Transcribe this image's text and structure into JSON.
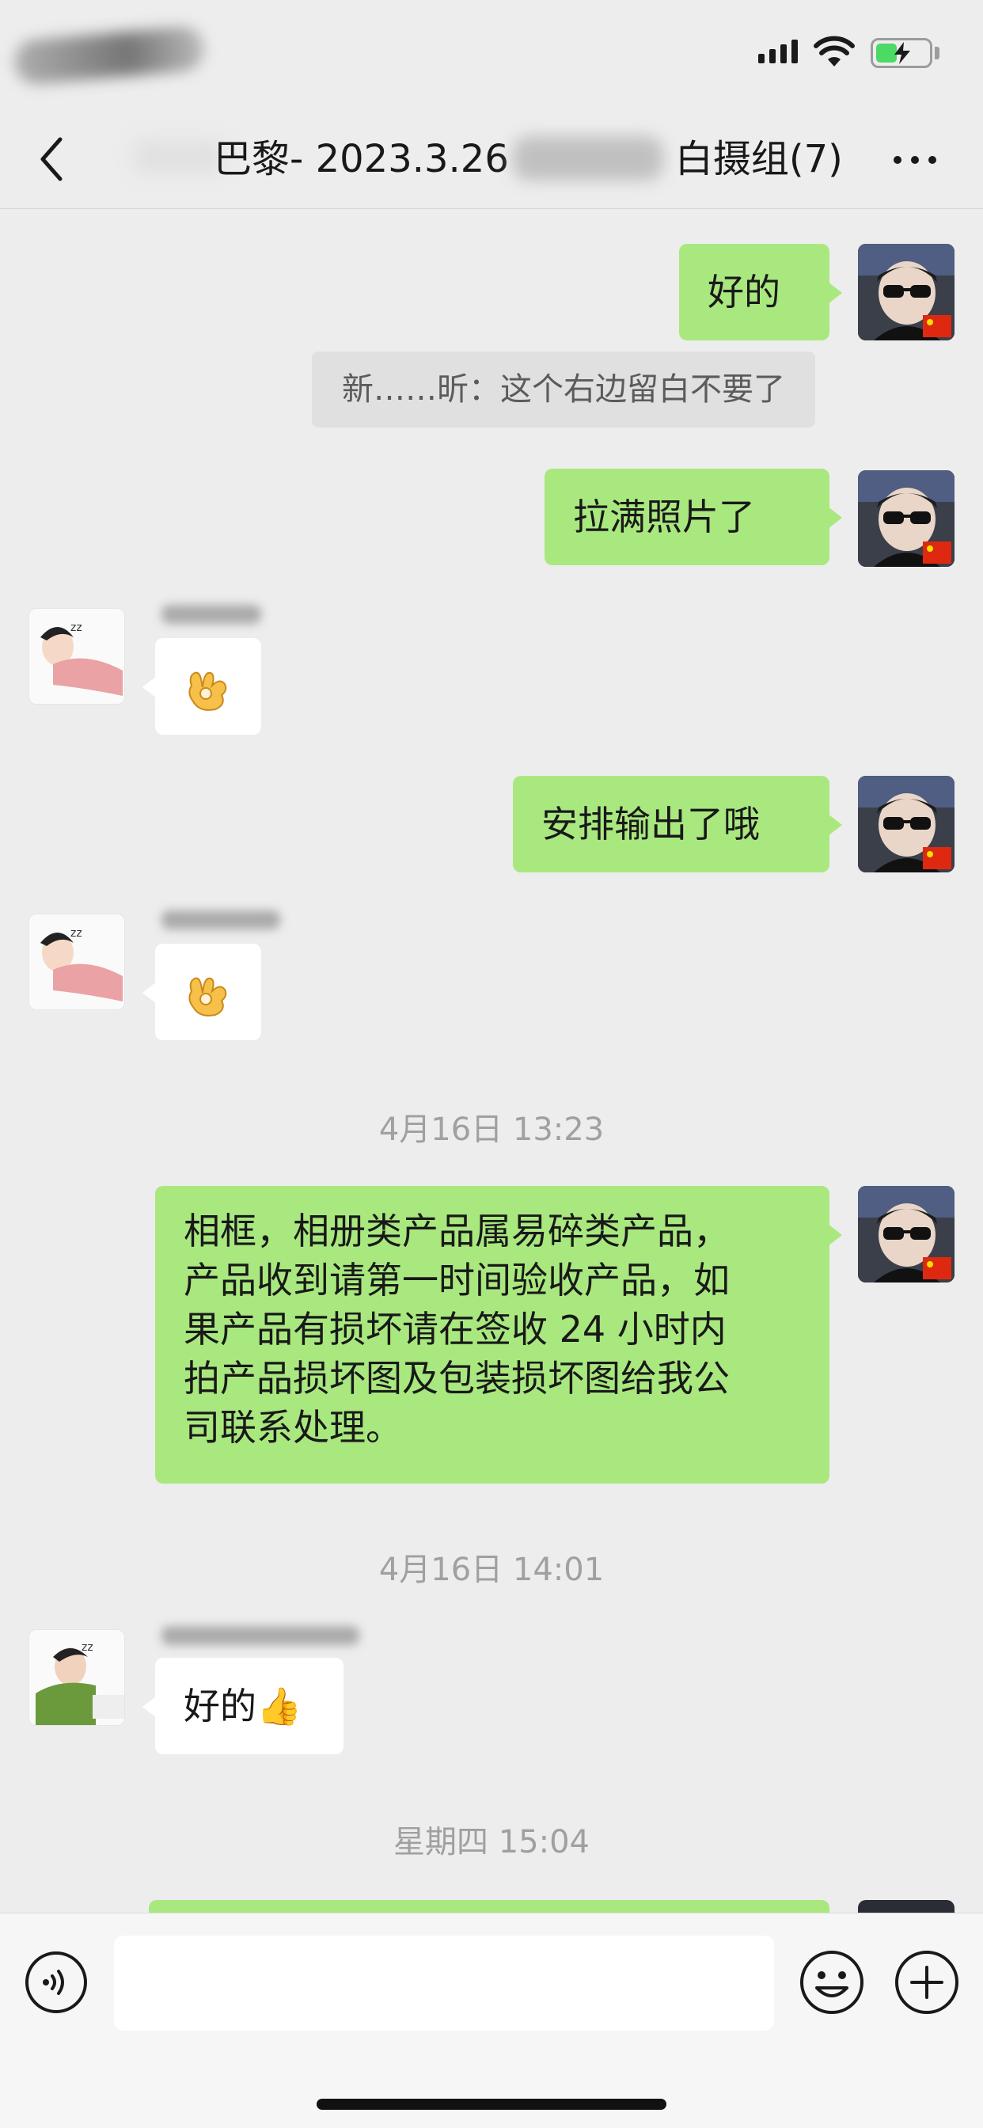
{
  "nav": {
    "title_prefix": "巴黎- 2023.3.26",
    "title_suffix": "白摄组(7)"
  },
  "messages": [
    {
      "side": "me",
      "text": "好的"
    },
    {
      "side": "quote",
      "text": "新……昕：这个右边留白不要了"
    },
    {
      "side": "me",
      "text": "拉满照片了"
    },
    {
      "side": "them",
      "emoji": "ok-hand"
    },
    {
      "side": "me",
      "text": "安排输出了哦"
    },
    {
      "side": "them",
      "emoji": "ok-hand"
    },
    {
      "side": "time",
      "text": "4月16日 13:23"
    },
    {
      "side": "me",
      "lines": [
        "相框，相册类产品属易碎类产品，",
        "产品收到请第一时间验收产品，如",
        "果产品有损坏请在签收 24 小时内",
        "拍产品损坏图及包装损坏图给我公",
        "司联系处理。"
      ]
    },
    {
      "side": "time",
      "text": "4月16日 14:01"
    },
    {
      "side": "them",
      "text": "好的👍"
    },
    {
      "side": "time",
      "text": "星期四 15:04"
    }
  ],
  "input": {
    "placeholder": ""
  },
  "colors": {
    "bubble_me": "#a9e87f",
    "bubble_them": "#ffffff",
    "background": "#ededed"
  }
}
